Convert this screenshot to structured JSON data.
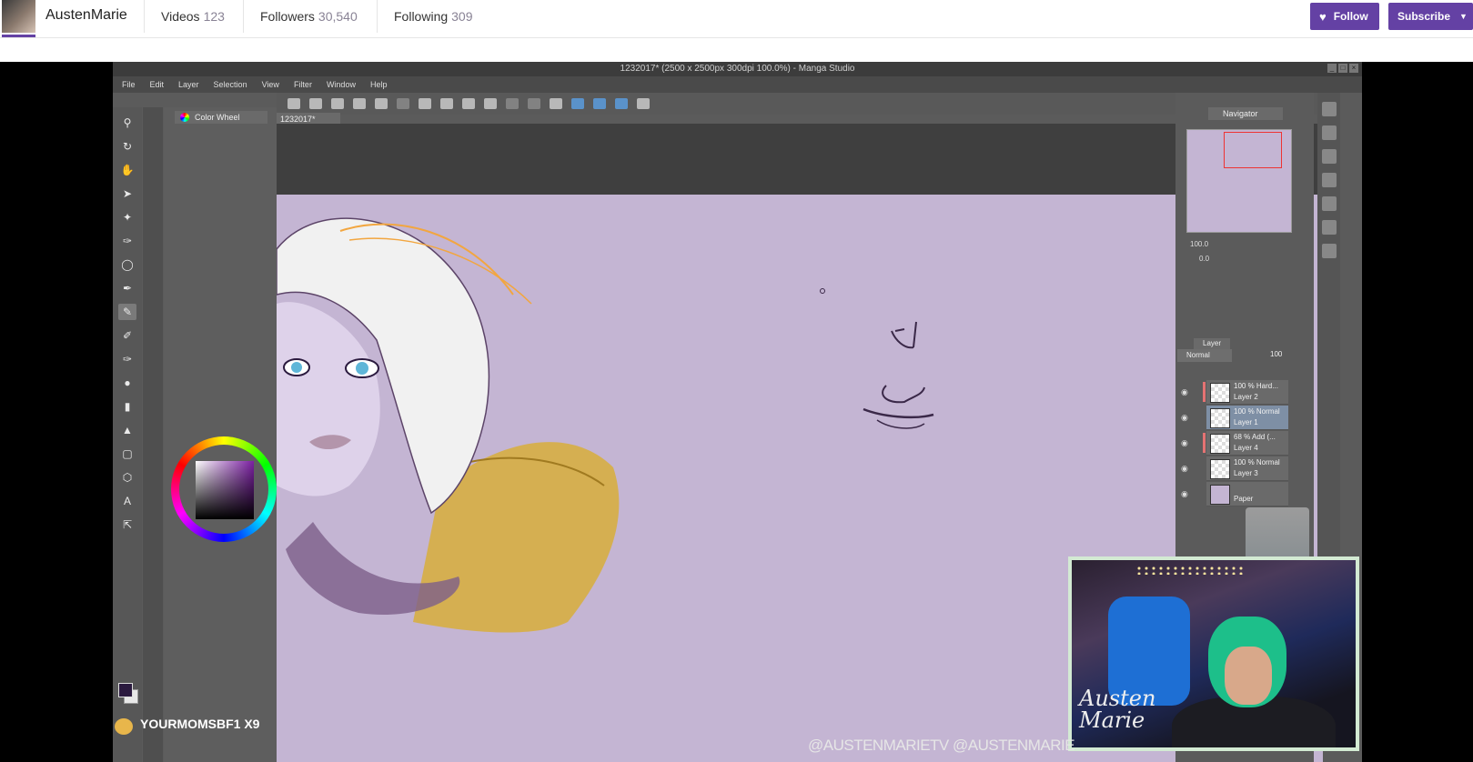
{
  "channel": {
    "name": "AustenMarie",
    "stats": [
      {
        "label": "Videos",
        "count": "123"
      },
      {
        "label": "Followers",
        "count": "30,540"
      },
      {
        "label": "Following",
        "count": "309"
      }
    ],
    "follow_label": "Follow",
    "subscribe_label": "Subscribe"
  },
  "app": {
    "title": "1232017* (2500 x 2500px 300dpi 100.0%)  - Manga Studio",
    "menu": [
      "File",
      "Edit",
      "Layer",
      "Selection",
      "View",
      "Filter",
      "Window",
      "Help"
    ],
    "doc_tab": "1232017*",
    "color_wheel_tab": "Color Wheel",
    "navigator_tab": "Navigator",
    "navigator_zoom": "100.0",
    "navigator_rotate": "0.0",
    "layer_tab": "Layer",
    "blend_mode": "Normal",
    "opacity": "100",
    "layers": [
      {
        "meta": "100 %  Hard...",
        "name": "Layer 2",
        "selected": false
      },
      {
        "meta": "100 %  Normal",
        "name": "Layer 1",
        "selected": true
      },
      {
        "meta": "68 %  Add (...",
        "name": "Layer 4",
        "selected": false
      },
      {
        "meta": "100 %  Normal",
        "name": "Layer 3",
        "selected": false
      },
      {
        "meta": "",
        "name": "Paper",
        "selected": false
      }
    ]
  },
  "overlay": {
    "alert_text": "YOURMOMSBF1 X9",
    "social_text": "@AUSTENMARIETV  @AUSTENMARIE",
    "webcam_signature_line1": "Austen",
    "webcam_signature_line2": "Marie"
  },
  "colors": {
    "twitch_purple": "#6441a4",
    "canvas_bg": "#c4b5d3",
    "app_gray": "#5b5b5b"
  }
}
